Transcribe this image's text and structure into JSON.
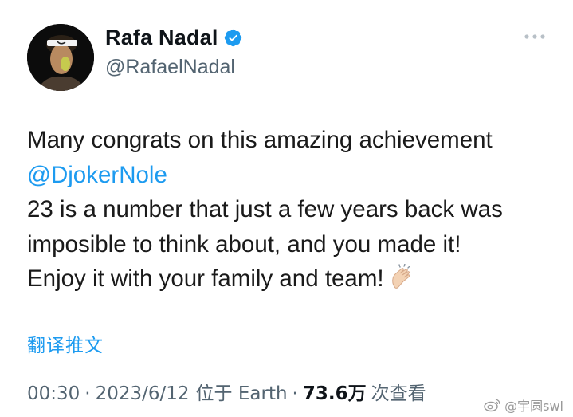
{
  "author": {
    "display_name": "Rafa Nadal",
    "handle": "@RafaelNadal"
  },
  "tweet": {
    "line1": "Many congrats on this amazing achievement",
    "mention": "@DjokerNole",
    "line3": "23 is a number that just a few years back was",
    "line4": "imposible to think about, and you made it!",
    "line5": "Enjoy it with your family and team!"
  },
  "translate_label": "翻译推文",
  "meta": {
    "time": "00:30",
    "date": "2023/6/12",
    "location": "位于 Earth",
    "views": "73.6万",
    "views_label": "次查看"
  },
  "watermark": "@宇圆swl",
  "icons": {
    "verified": "verified-badge-icon",
    "more": "more-options-icon",
    "emoji": "clapping-hands-icon",
    "weibo": "weibo-logo-icon"
  },
  "colors": {
    "accent": "#1d9bf0",
    "secondary_text": "#536471",
    "primary_text": "#0f1419"
  }
}
